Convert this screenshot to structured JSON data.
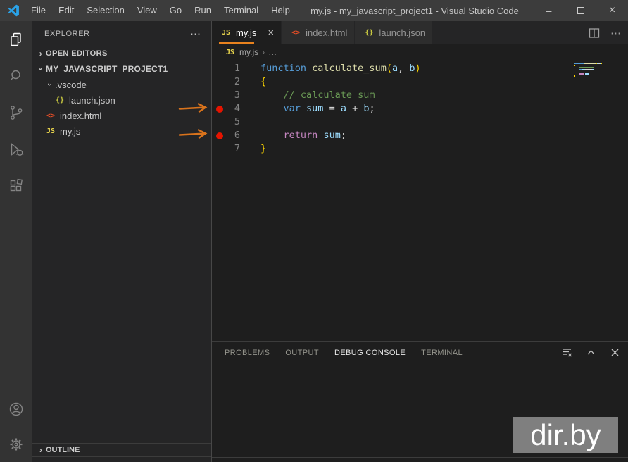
{
  "titlebar": {
    "title": "my.js - my_javascript_project1 - Visual Studio Code",
    "menus": [
      "File",
      "Edit",
      "Selection",
      "View",
      "Go",
      "Run",
      "Terminal",
      "Help"
    ],
    "window_controls": [
      "minimize",
      "maximize",
      "close"
    ]
  },
  "activity_bar": {
    "items": [
      "explorer",
      "search",
      "source-control",
      "run-and-debug",
      "extensions"
    ],
    "active": "explorer",
    "bottom_items": [
      "accounts",
      "settings"
    ]
  },
  "sidebar": {
    "title": "EXPLORER",
    "more_actions": "⋯",
    "open_editors_label": "OPEN EDITORS",
    "root_label": "MY_JAVASCRIPT_PROJECT1",
    "outline_label": "OUTLINE",
    "tree": [
      {
        "label": ".vscode",
        "icon": "folder",
        "expanded": true,
        "indent": 1
      },
      {
        "label": "launch.json",
        "icon": "json",
        "indent": 2
      },
      {
        "label": "index.html",
        "icon": "html",
        "indent": 1
      },
      {
        "label": "my.js",
        "icon": "js",
        "indent": 1
      }
    ]
  },
  "editor_tabs": [
    {
      "label": "my.js",
      "icon": "js",
      "active": true,
      "closable": true
    },
    {
      "label": "index.html",
      "icon": "html",
      "active": false
    },
    {
      "label": "launch.json",
      "icon": "json",
      "active": false
    }
  ],
  "editor_actions": [
    "split-editor",
    "more-actions"
  ],
  "breadcrumb": {
    "icon": "js",
    "file": "my.js",
    "separator": "›",
    "more": "…"
  },
  "editor": {
    "language": "javascript",
    "breakpoint_lines": [
      4,
      6
    ],
    "lines": [
      {
        "n": 1,
        "bp": false,
        "seg": [
          [
            "function ",
            "kw"
          ],
          [
            "calculate_sum",
            "fn"
          ],
          [
            "(",
            "brk"
          ],
          [
            "a",
            "vr"
          ],
          [
            ", ",
            "fg"
          ],
          [
            "b",
            "vr"
          ],
          [
            ")",
            "brk"
          ]
        ]
      },
      {
        "n": 2,
        "bp": false,
        "seg": [
          [
            "{",
            "brk"
          ]
        ]
      },
      {
        "n": 3,
        "bp": false,
        "seg": [
          [
            "    ",
            "fg"
          ],
          [
            "// calculate sum",
            "cm"
          ]
        ]
      },
      {
        "n": 4,
        "bp": true,
        "seg": [
          [
            "    ",
            "fg"
          ],
          [
            "var",
            "kw"
          ],
          [
            " ",
            "fg"
          ],
          [
            "sum",
            "vr"
          ],
          [
            " = ",
            "fg"
          ],
          [
            "a",
            "vr"
          ],
          [
            " + ",
            "fg"
          ],
          [
            "b",
            "vr"
          ],
          [
            ";",
            "fg"
          ]
        ]
      },
      {
        "n": 5,
        "bp": false,
        "seg": []
      },
      {
        "n": 6,
        "bp": true,
        "seg": [
          [
            "    ",
            "fg"
          ],
          [
            "return",
            "ct"
          ],
          [
            " ",
            "fg"
          ],
          [
            "sum",
            "vr"
          ],
          [
            ";",
            "fg"
          ]
        ]
      },
      {
        "n": 7,
        "bp": false,
        "seg": [
          [
            "}",
            "brk"
          ]
        ]
      }
    ]
  },
  "panel": {
    "tabs": [
      "PROBLEMS",
      "OUTPUT",
      "DEBUG CONSOLE",
      "TERMINAL"
    ],
    "active": "DEBUG CONSOLE",
    "actions": [
      "clear-console",
      "maximize-panel",
      "close-panel"
    ]
  },
  "annotations": {
    "arrow_color": "#D9731C",
    "arrows": [
      {
        "points_to": "breakpoint-line-4"
      },
      {
        "points_to": "breakpoint-line-6"
      }
    ]
  },
  "watermark": {
    "text": "dir.by"
  },
  "file_icon_glyphs": {
    "js": "JS",
    "json": "{}",
    "html": "<>"
  },
  "colors": {
    "accent_orange": "#E8821E",
    "breakpoint_red": "#E51400",
    "kw": "#569CD6",
    "fn": "#DCDCAA",
    "vr": "#9CDCFE",
    "cm": "#6A9955",
    "ct": "#C586C0",
    "brk": "#FFD700",
    "fg": "#D4D4D4",
    "titlebar_bg": "#3C3C3C",
    "activitybar_bg": "#333333",
    "sidebar_bg": "#252526",
    "editor_bg": "#1E1E1E",
    "watermark_bg": "#7F7F7F"
  }
}
